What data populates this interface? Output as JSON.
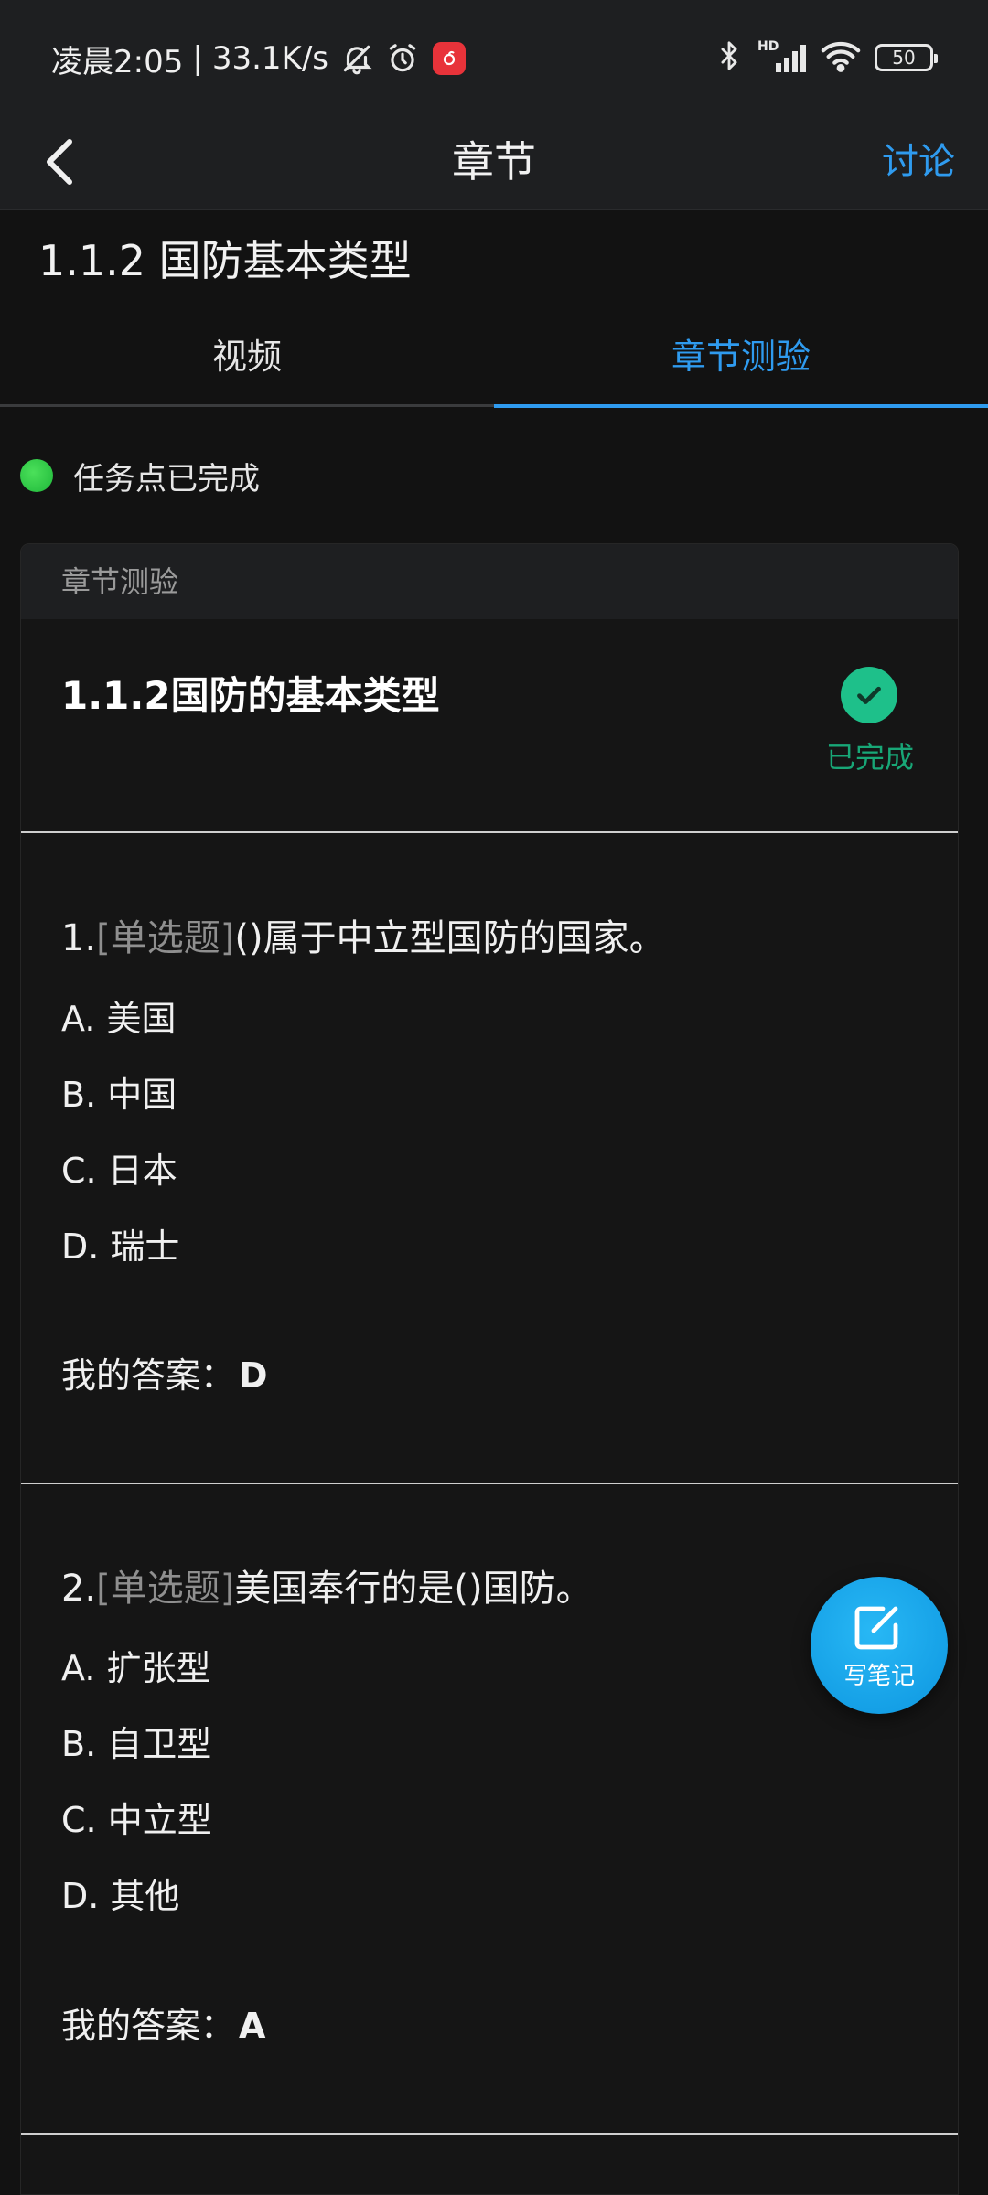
{
  "status_bar": {
    "time": "凌晨2:05",
    "separator": "|",
    "net_speed": "33.1K/s",
    "hd_label": "HD",
    "battery": "50"
  },
  "nav": {
    "title": "章节",
    "discuss": "讨论"
  },
  "chapter": {
    "title": "1.1.2 国防基本类型"
  },
  "tabs": [
    {
      "label": "视频"
    },
    {
      "label": "章节测验"
    }
  ],
  "task_status": "任务点已完成",
  "card": {
    "header": "章节测验",
    "quiz_title": "1.1.2国防的基本类型",
    "done_label": "已完成"
  },
  "questions": [
    {
      "number": "1.",
      "type": "[单选题]",
      "text": "()属于中立型国防的国家。",
      "options": [
        "A. 美国",
        "B. 中国",
        "C. 日本",
        "D. 瑞士"
      ],
      "answer_label": "我的答案：",
      "answer": "D"
    },
    {
      "number": "2.",
      "type": "[单选题]",
      "text": "美国奉行的是()国防。",
      "options": [
        "A. 扩张型",
        "B. 自卫型",
        "C. 中立型",
        "D. 其他"
      ],
      "answer_label": "我的答案：",
      "answer": "A"
    }
  ],
  "fab": {
    "label": "写笔记"
  },
  "colors": {
    "accent": "#2f9bef",
    "success": "#1ec08a",
    "background": "#121212"
  }
}
